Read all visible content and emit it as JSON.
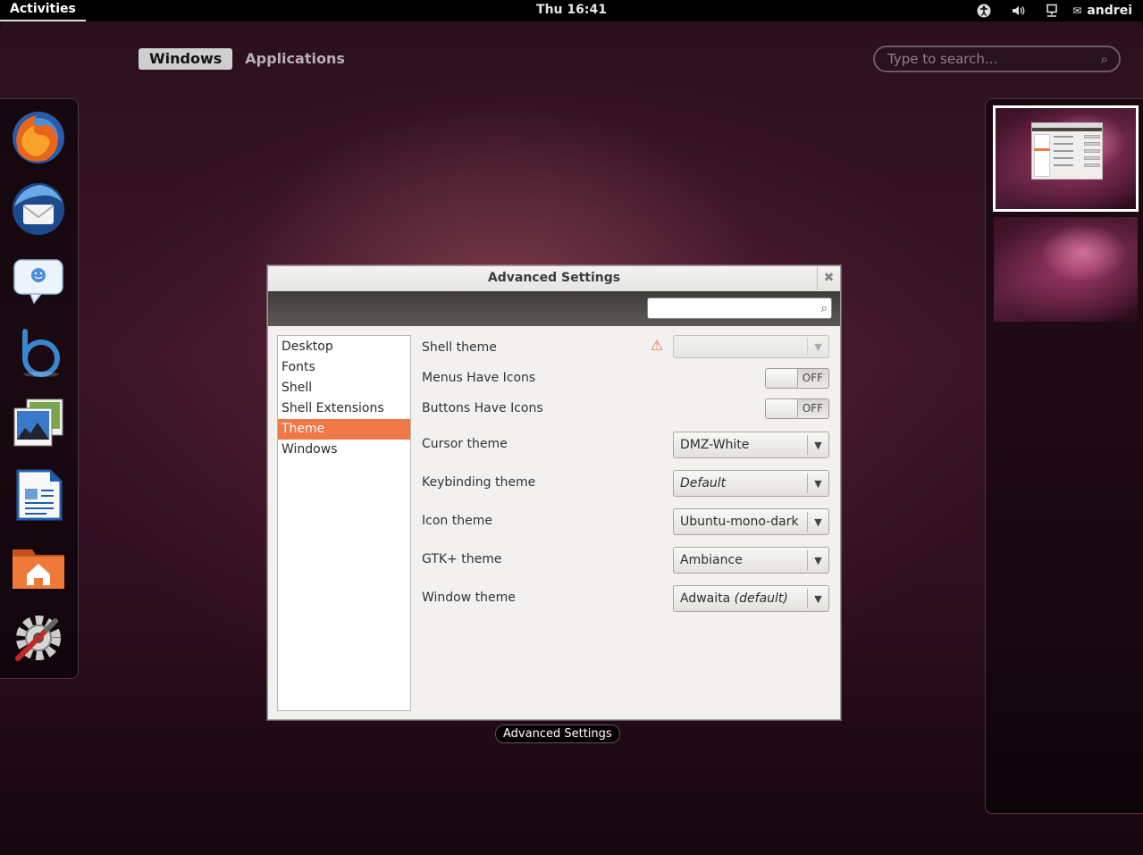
{
  "top_panel": {
    "activities_label": "Activities",
    "clock": "Thu 16:41",
    "user_name": "andrei",
    "status_icons": [
      "accessibility-icon",
      "volume-icon",
      "network-icon"
    ]
  },
  "overview": {
    "tabs": [
      {
        "label": "Windows",
        "active": true
      },
      {
        "label": "Applications",
        "active": false
      }
    ],
    "search_placeholder": "Type to search..."
  },
  "dash": {
    "apps": [
      "firefox-icon",
      "thunderbird-icon",
      "empathy-icon",
      "banshee-icon",
      "shotwell-icon",
      "libreoffice-writer-icon",
      "home-folder-icon",
      "system-settings-icon"
    ]
  },
  "window": {
    "title": "Advanced Settings",
    "caption": "Advanced Settings",
    "sidebar_items": [
      "Desktop",
      "Fonts",
      "Shell",
      "Shell Extensions",
      "Theme",
      "Windows"
    ],
    "selected_item": "Theme",
    "settings": {
      "shell_theme_label": "Shell theme",
      "menus_icons_label": "Menus Have Icons",
      "menus_icons_state": "OFF",
      "buttons_icons_label": "Buttons Have Icons",
      "buttons_icons_state": "OFF",
      "cursor_theme_label": "Cursor theme",
      "cursor_theme_value": "DMZ-White",
      "keybinding_theme_label": "Keybinding theme",
      "keybinding_theme_value": "Default",
      "icon_theme_label": "Icon theme",
      "icon_theme_value": "Ubuntu-mono-dark",
      "gtk_theme_label": "GTK+ theme",
      "gtk_theme_value": "Ambiance",
      "window_theme_label": "Window theme",
      "window_theme_value": "Adwaita",
      "window_theme_suffix": "(default)"
    }
  },
  "colors": {
    "accent": "#f07746",
    "warning": "#ef6c2e"
  }
}
